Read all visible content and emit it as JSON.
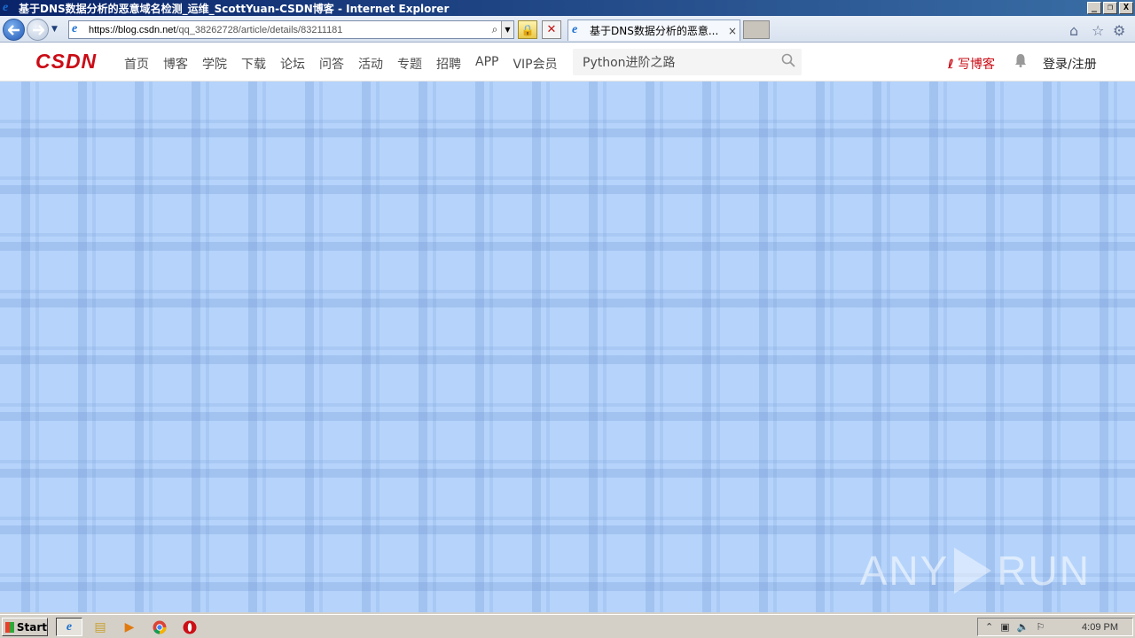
{
  "window": {
    "title": "基于DNS数据分析的恶意域名检测_运维_ScottYuan-CSDN博客 - Internet Explorer",
    "minimize": "_",
    "restore": "❐",
    "close": "X"
  },
  "browser": {
    "url_host": "https://blog.csdn.net",
    "url_path": "/qq_38262728/article/details/83211181",
    "tab_label": "基于DNS数据分析的恶意...",
    "tab_close": "×",
    "search_glyph": "⌕",
    "dropdown_glyph": "▼",
    "lock_glyph": "🔒",
    "stop_glyph": "✕"
  },
  "csdn": {
    "logo": "CSDN",
    "nav": [
      "首页",
      "博客",
      "学院",
      "下载",
      "论坛",
      "问答",
      "活动",
      "专题",
      "招聘",
      "APP",
      "VIP会员"
    ],
    "search_text": "Python进阶之路",
    "write_blog": "写博客",
    "login": "登录/注册"
  },
  "watermark": {
    "left": "ANY",
    "right": "RUN"
  },
  "taskbar": {
    "start": "Start",
    "clock": "4:09 PM"
  },
  "colors": {
    "brand_red": "#ca0c16",
    "page_background": "#b6d4fb"
  }
}
